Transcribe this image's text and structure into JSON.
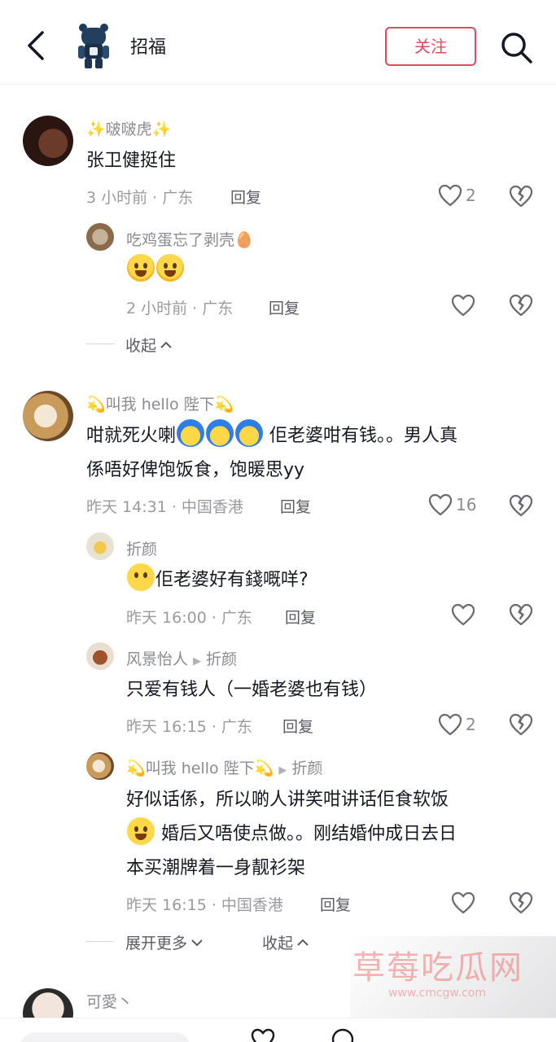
{
  "header": {
    "title": "招福",
    "follow_label": "关注"
  },
  "comments": [
    {
      "username": "✨啵啵虎✨",
      "text": "张卫健挺住",
      "meta": "3 小时前 · 广东",
      "reply_label": "回复",
      "likes": "2"
    },
    {
      "username": "吃鸡蛋忘了剥壳🥚",
      "meta": "2 小时前 · 广东",
      "reply_label": "回复"
    },
    {
      "username": "💫叫我 hello 陛下💫",
      "text_line1_a": "咁就死火喇",
      "text_line1_b": "佢老婆咁有钱。。男人真",
      "text_line2": "係唔好俾饱饭食，饱暖思yy",
      "meta": "昨天 14:31 · 中国香港",
      "reply_label": "回复",
      "likes": "16"
    },
    {
      "username": "折颜",
      "text": "佢老婆好有錢嘅咩?",
      "meta": "昨天 16:00 · 广东",
      "reply_label": "回复"
    },
    {
      "username": "风景怡人",
      "reply_to": "折颜",
      "text": "只爱有钱人（一婚老婆也有钱）",
      "meta": "昨天 16:15 · 广东",
      "reply_label": "回复",
      "likes": "2"
    },
    {
      "username": "💫叫我 hello 陛下💫",
      "reply_to": "折颜",
      "text_line1": "好似话係，所以啲人讲笑咁讲话佢食软饭",
      "text_line2": "婚后又唔使点做。。刚结婚仲成日去日",
      "text_line3": "本买潮牌着一身靓衫架",
      "meta": "昨天 16:15 · 中国香港",
      "reply_label": "回复"
    },
    {
      "username": "可愛丶"
    }
  ],
  "collapse_label_1": "收起",
  "expand_more_label": "展开更多",
  "collapse_label_2": "收起",
  "watermark": {
    "title": "草莓吃瓜网",
    "url": "www.cmcgw.com"
  },
  "icons": [
    "back-icon",
    "search-icon",
    "heart-icon",
    "broken-heart-icon",
    "chevron-up-icon",
    "chevron-down-icon"
  ]
}
